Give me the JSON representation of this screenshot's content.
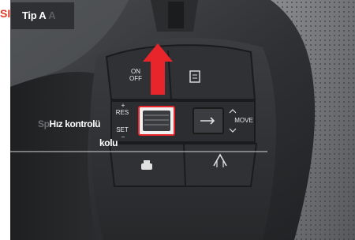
{
  "edge_label": "SI",
  "tab": {
    "label": "Tip A",
    "ghost": "A"
  },
  "callout": {
    "line1_ghost": "Sp",
    "line1": "Hız kontrolü",
    "line2_ghost": "",
    "line2": "kolu"
  },
  "buttons": {
    "on_off_line1": "ON",
    "on_off_line2": "OFF",
    "res_plus": "+",
    "res": "RES",
    "set": "SET",
    "set_minus": "−",
    "move": "MOVE"
  },
  "colors": {
    "highlight": "#e8252b",
    "arrow": "#e8252b",
    "dash": "#2f3134"
  }
}
